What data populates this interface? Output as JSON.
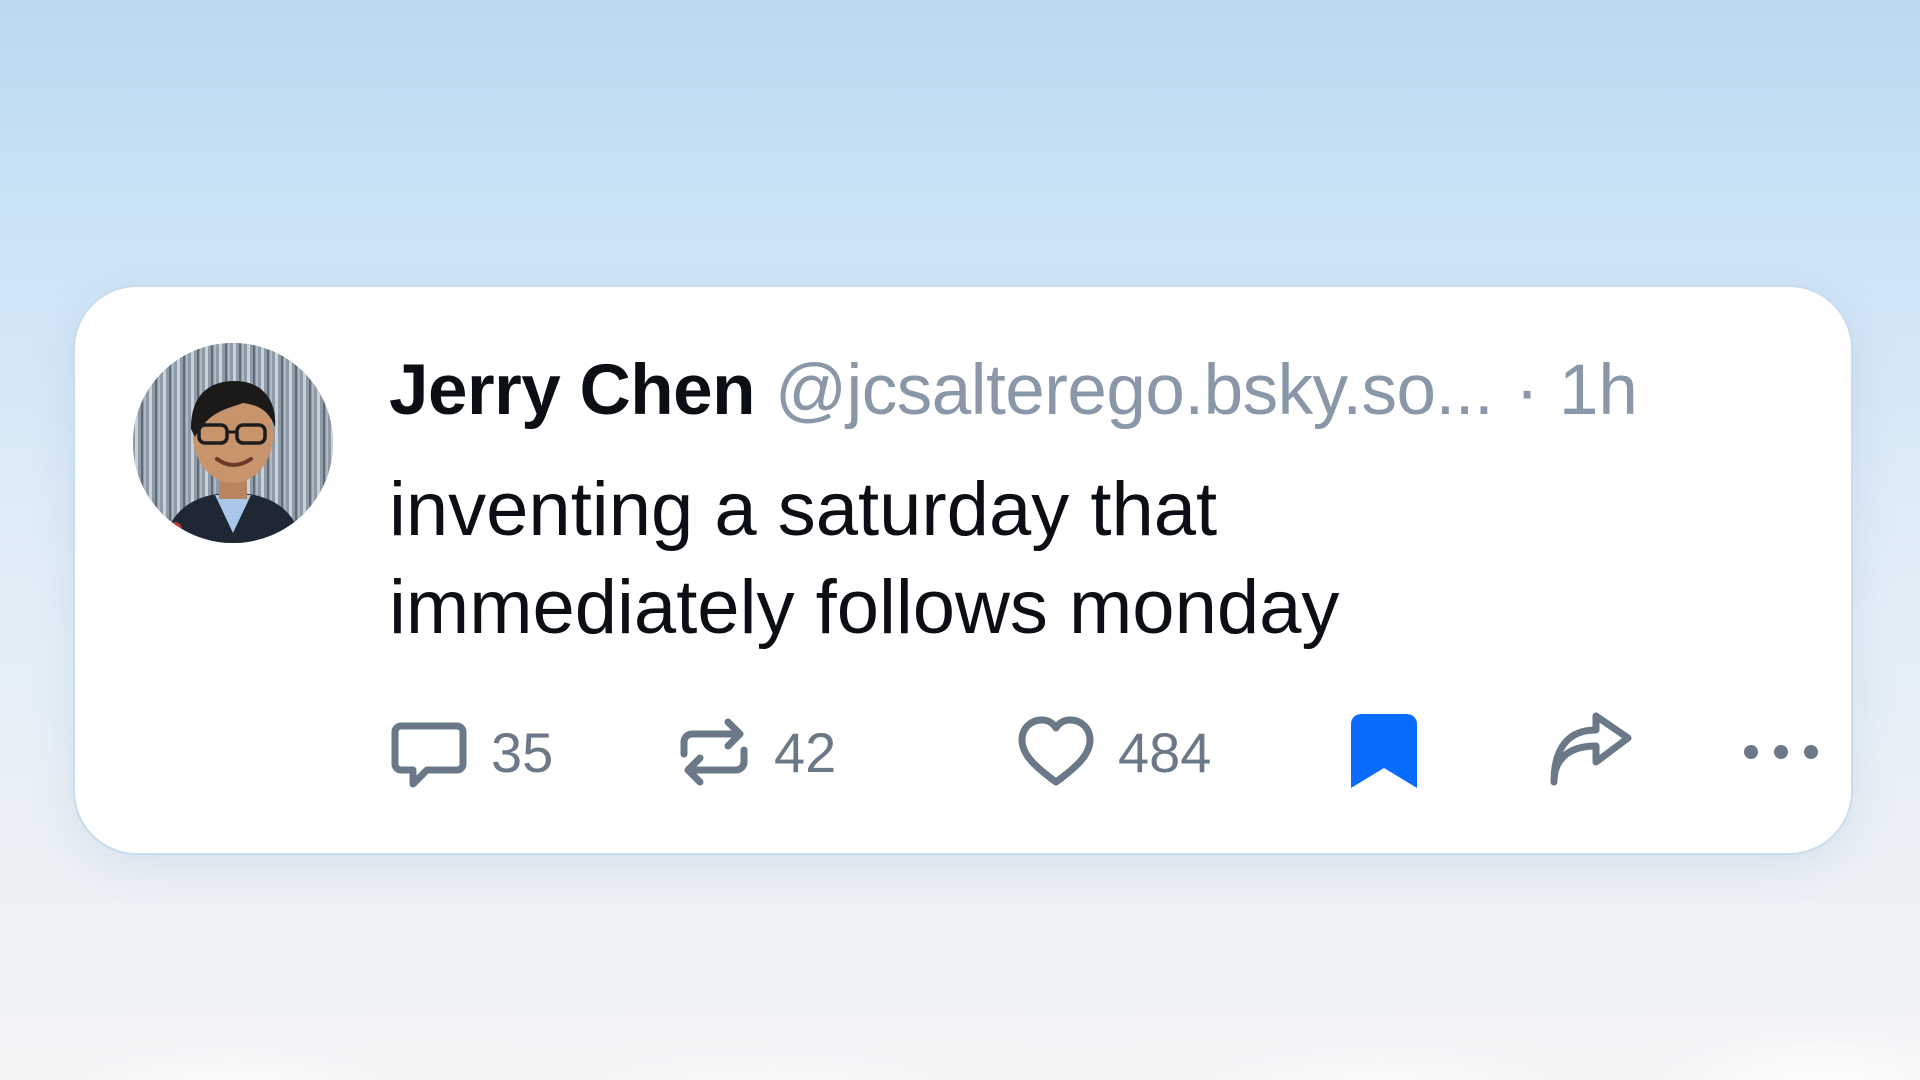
{
  "post": {
    "author": {
      "display_name": "Jerry Chen",
      "handle": "@jcsalterego.bsky.so...",
      "separator": "·",
      "time": "1h"
    },
    "text": "inventing a saturday that immediately follows monday",
    "actions": {
      "reply": {
        "icon": "speech-bubble-icon",
        "count": "35"
      },
      "repost": {
        "icon": "repost-icon",
        "count": "42"
      },
      "like": {
        "icon": "heart-icon",
        "count": "484"
      },
      "bookmark": {
        "icon": "bookmark-icon",
        "active": true,
        "color": "#0a6cff"
      },
      "share": {
        "icon": "share-arrow-icon"
      },
      "more": {
        "icon": "more-dots-icon"
      }
    }
  },
  "colors": {
    "text_primary": "#0b0f14",
    "text_muted": "#8a97a8",
    "icon_muted": "#6b7888",
    "accent": "#0a6cff",
    "card_border": "#c9dcef"
  }
}
